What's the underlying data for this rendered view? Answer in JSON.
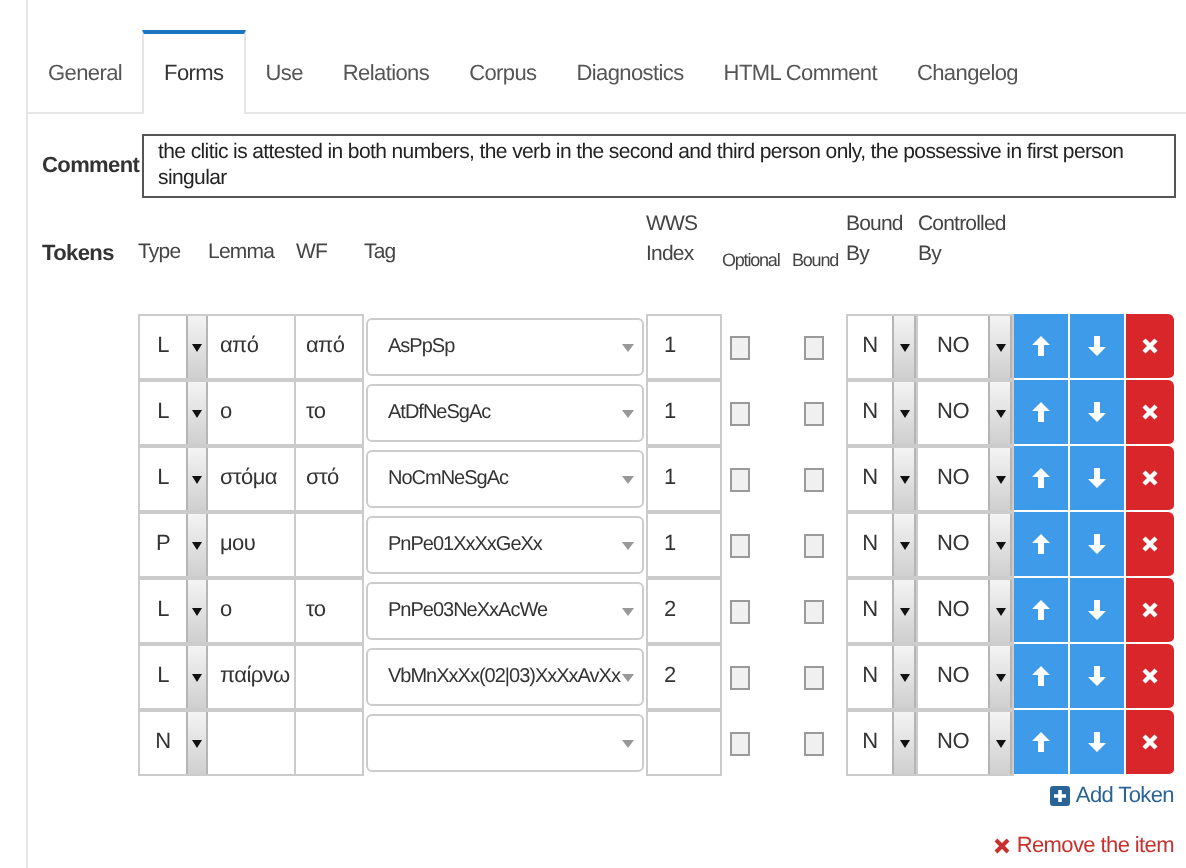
{
  "tabs": [
    {
      "label": "General",
      "selected": false
    },
    {
      "label": "Forms",
      "selected": true
    },
    {
      "label": "Use",
      "selected": false
    },
    {
      "label": "Relations",
      "selected": false
    },
    {
      "label": "Corpus",
      "selected": false
    },
    {
      "label": "Diagnostics",
      "selected": false
    },
    {
      "label": "HTML Comment",
      "selected": false
    },
    {
      "label": "Changelog",
      "selected": false
    }
  ],
  "comment": {
    "label": "Comment",
    "value": "the clitic is attested in both numbers, the verb in the second and third person only, the possessive in first person singular"
  },
  "tokens": {
    "label": "Tokens",
    "columns": [
      "Type",
      "Lemma",
      "WF",
      "Tag",
      "WWS Index",
      "Optional",
      "Bound",
      "Bound By",
      "Controlled By"
    ],
    "rows": [
      {
        "type": "L",
        "lemma": "από",
        "wf": "από",
        "tag": "AsPpSp",
        "index": "1",
        "optional": false,
        "bound": false,
        "bound_by": "N",
        "controlled_by": "NO"
      },
      {
        "type": "L",
        "lemma": "ο",
        "wf": "το",
        "tag": "AtDfNeSgAc",
        "index": "1",
        "optional": false,
        "bound": false,
        "bound_by": "N",
        "controlled_by": "NO"
      },
      {
        "type": "L",
        "lemma": "στόμα",
        "wf": "στό",
        "tag": "NoCmNeSgAc",
        "index": "1",
        "optional": false,
        "bound": false,
        "bound_by": "N",
        "controlled_by": "NO"
      },
      {
        "type": "P",
        "lemma": "μου",
        "wf": "",
        "tag": "PnPe01XxXxGeXx",
        "index": "1",
        "optional": false,
        "bound": false,
        "bound_by": "N",
        "controlled_by": "NO"
      },
      {
        "type": "L",
        "lemma": "ο",
        "wf": "το",
        "tag": "PnPe03NeXxAcWe",
        "index": "2",
        "optional": false,
        "bound": false,
        "bound_by": "N",
        "controlled_by": "NO"
      },
      {
        "type": "L",
        "lemma": "παίρνω",
        "wf": "",
        "tag": "VbMnXxXx(02|03)XxXxAvXx",
        "index": "2",
        "optional": false,
        "bound": false,
        "bound_by": "N",
        "controlled_by": "NO"
      },
      {
        "type": "N",
        "lemma": "",
        "wf": "",
        "tag": "",
        "index": "",
        "optional": false,
        "bound": false,
        "bound_by": "N",
        "controlled_by": "NO"
      }
    ],
    "add_label": "Add Token"
  },
  "remove_label": "Remove the item"
}
